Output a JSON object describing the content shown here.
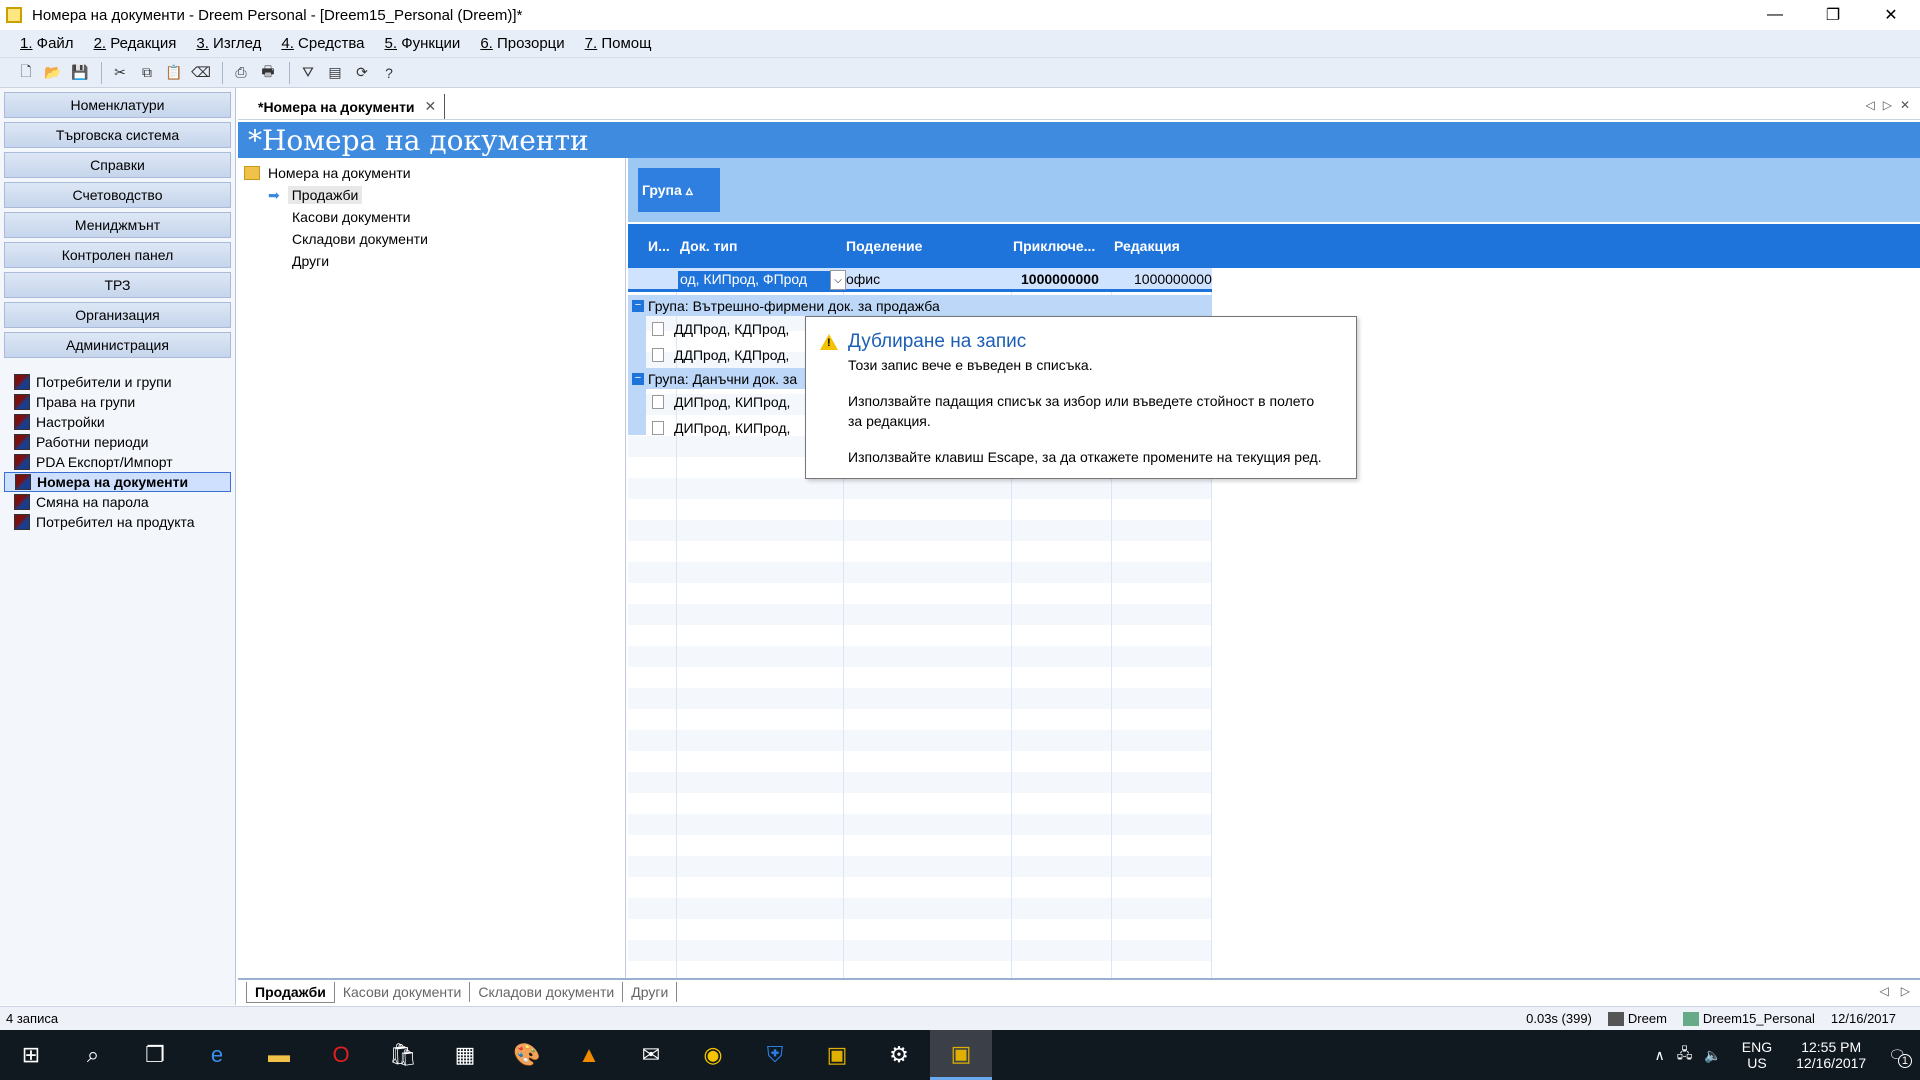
{
  "window": {
    "title": "Номера на документи - Dreem Personal - [Dreem15_Personal (Dreem)]*",
    "minimize": "—",
    "restore": "❐",
    "close": "✕"
  },
  "menu": [
    {
      "num": "1.",
      "label": " Файл"
    },
    {
      "num": "2.",
      "label": " Редакция"
    },
    {
      "num": "3.",
      "label": " Изглед"
    },
    {
      "num": "4.",
      "label": " Средства"
    },
    {
      "num": "5.",
      "label": " Функции"
    },
    {
      "num": "6.",
      "label": " Прозорци"
    },
    {
      "num": "7.",
      "label": " Помощ"
    }
  ],
  "sidebar": {
    "nav": [
      "Номенклатури",
      "Търговска система",
      "Справки",
      "Счетоводство",
      "Мениджмънт",
      "Контролен панел",
      "ТРЗ",
      "Организация",
      "Администрация"
    ],
    "admin_items": [
      "Потребители и групи",
      "Права на групи",
      "Настройки",
      "Работни периоди",
      "PDA Експорт/Импорт",
      "Номера на документи",
      "Смяна на парола",
      "Потребител на продукта"
    ]
  },
  "doc_tab": {
    "label": "*Номера на документи",
    "close": "✕"
  },
  "page_header": "*Номера на документи",
  "tree": {
    "root": "Номера на документи",
    "items": [
      "Продажби",
      "Касови документи",
      "Складови документи",
      "Други"
    ]
  },
  "grid": {
    "group_button": "Група ▵",
    "columns": [
      "И...",
      "Док. тип",
      "Поделение",
      "Приключе...",
      "Редакция"
    ],
    "edit_row": {
      "doc_type": "од, КИПрод, ФПрод",
      "division": "офис",
      "closed": "1000000000",
      "edition": "1000000000"
    },
    "groups": [
      {
        "label": "Група: Вътрешно-фирмени док. за продажба",
        "rows": [
          "ДДПрод, КДПрод,",
          "ДДПрод, КДПрод,"
        ]
      },
      {
        "label": "Група: Данъчни док. за",
        "rows": [
          "ДИПрод, КИПрод,",
          "ДИПрод, КИПрод,"
        ]
      }
    ]
  },
  "tooltip": {
    "title": "Дублиране на запис",
    "line1": "Този запис вече е въведен в списъка.",
    "line2": "Използвайте падащия списък за избор или въведете стойност в полето",
    "line3": "за редакция.",
    "line4": "Използвайте клавиш Escape, за да откажете промените на текущия ред."
  },
  "bottom_tabs": [
    "Продажби",
    "Касови документи",
    "Складови документи",
    "Други"
  ],
  "status": {
    "records": "4 записа",
    "timing": "0.03s (399)",
    "user": "Dreem",
    "db": "Dreem15_Personal",
    "date": "12/16/2017"
  },
  "taskbar": {
    "lang": "ENG",
    "region": "US",
    "time": "12:55 PM",
    "date": "12/16/2017",
    "notifications": "1"
  },
  "colors": {
    "header_blue": "#3f8be0",
    "grid_header": "#1f74db",
    "group_panel": "#9ec8f4",
    "tooltip_title": "#1c5fb4"
  }
}
